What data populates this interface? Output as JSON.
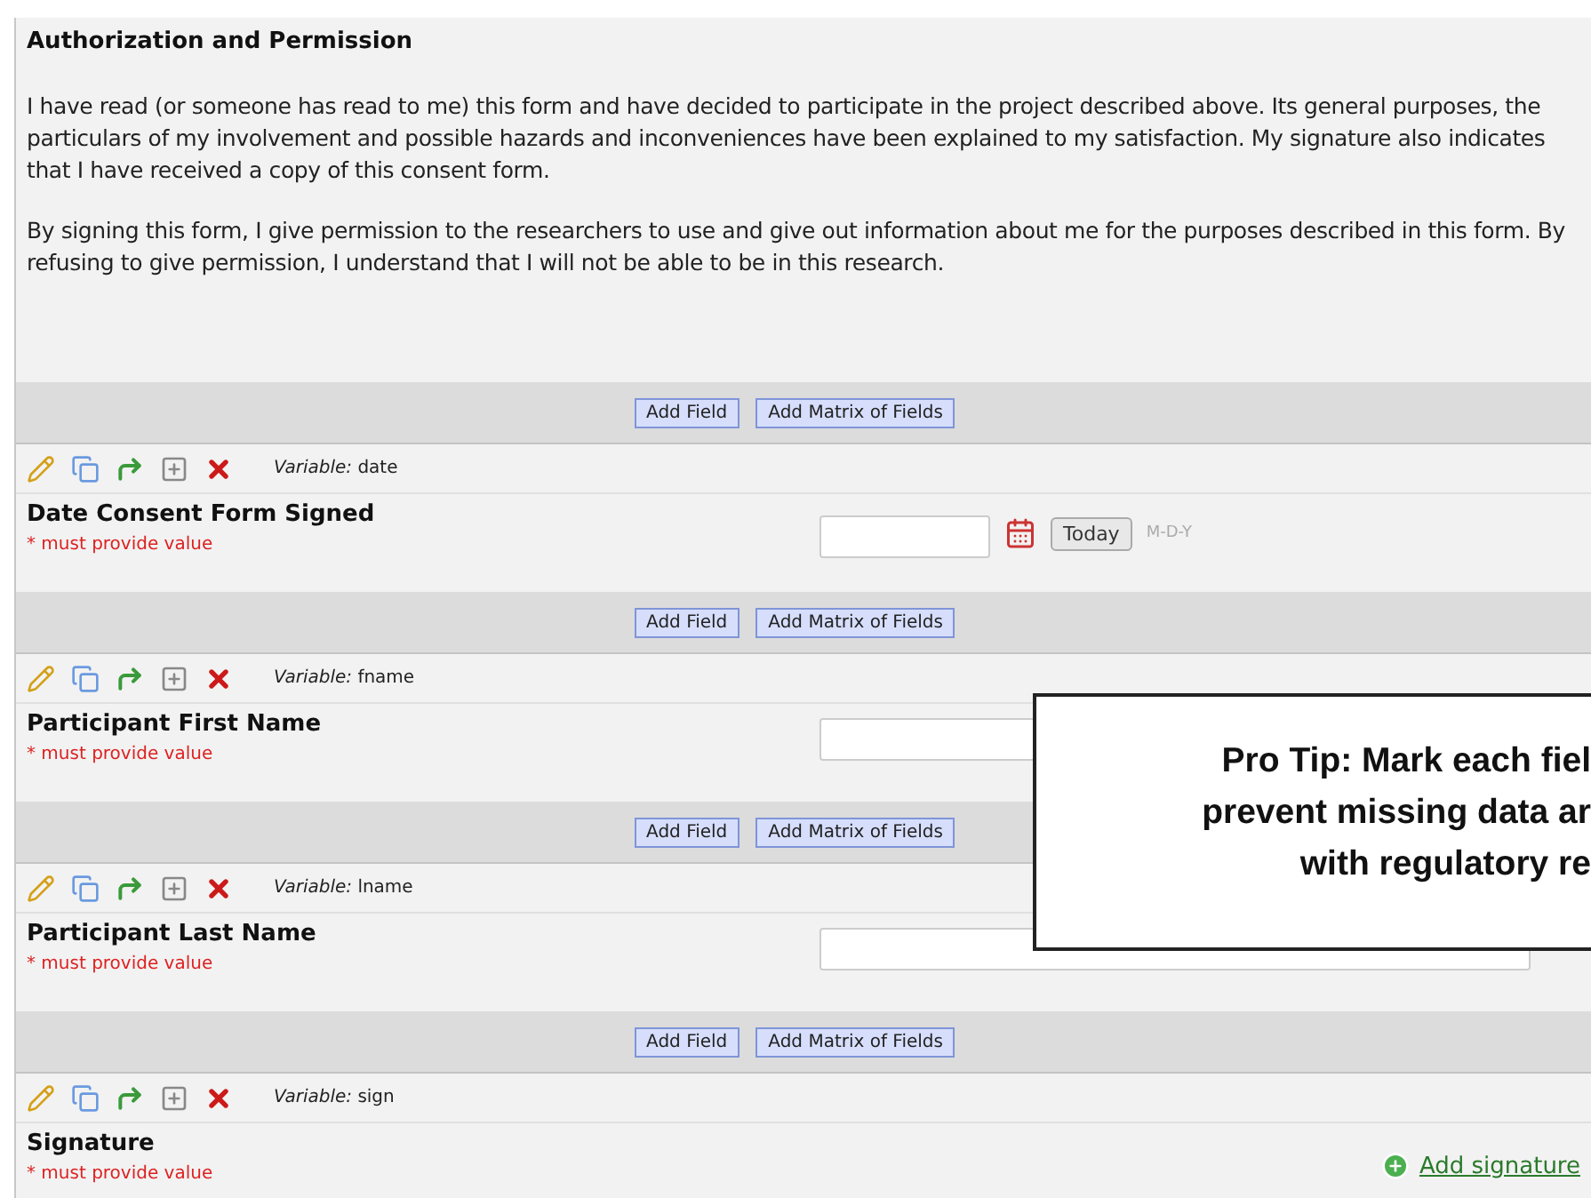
{
  "section": {
    "title": "Authorization and Permission",
    "paragraphs": [
      "I have read (or someone has read to me) this form and have decided to participate in the project described above. Its general purposes, the particulars of my involvement and possible hazards and inconveniences have been explained to my satisfaction. My signature also indicates that I have received a copy of this consent form.",
      "By signing this form, I give permission to the researchers to use and give out information about me for the purposes described in this form. By refusing to give permission, I understand that I will not be able to be in this research."
    ]
  },
  "fields": [
    {
      "add_field": "Add Field",
      "add_matrix": "Add Matrix of Fields",
      "kind": "date",
      "variable_label": "Variable:",
      "variable": "date",
      "label": "Date Consent Form Signed",
      "required_note": "* must provide value",
      "today_button": "Today",
      "format": "M-D-Y"
    },
    {
      "add_field": "Add Field",
      "add_matrix": "Add Matrix of Fields",
      "kind": "text",
      "variable_label": "Variable:",
      "variable": "fname",
      "label": "Participant First Name",
      "required_note": "* must provide value"
    },
    {
      "add_field": "Add Field",
      "add_matrix": "Add Matrix of Fields",
      "kind": "text",
      "variable_label": "Variable:",
      "variable": "lname",
      "label": "Participant Last Name",
      "required_note": "* must provide value"
    },
    {
      "add_field": "Add Field",
      "add_matrix": "Add Matrix of Fields",
      "kind": "signature",
      "variable_label": "Variable:",
      "variable": "sign",
      "label": "Signature",
      "required_note": "* must provide value",
      "link": "Add signature"
    }
  ],
  "callout": {
    "lines": [
      "Pro Tip: Mark each fiel",
      "prevent missing data ar",
      "with regulatory re"
    ]
  }
}
